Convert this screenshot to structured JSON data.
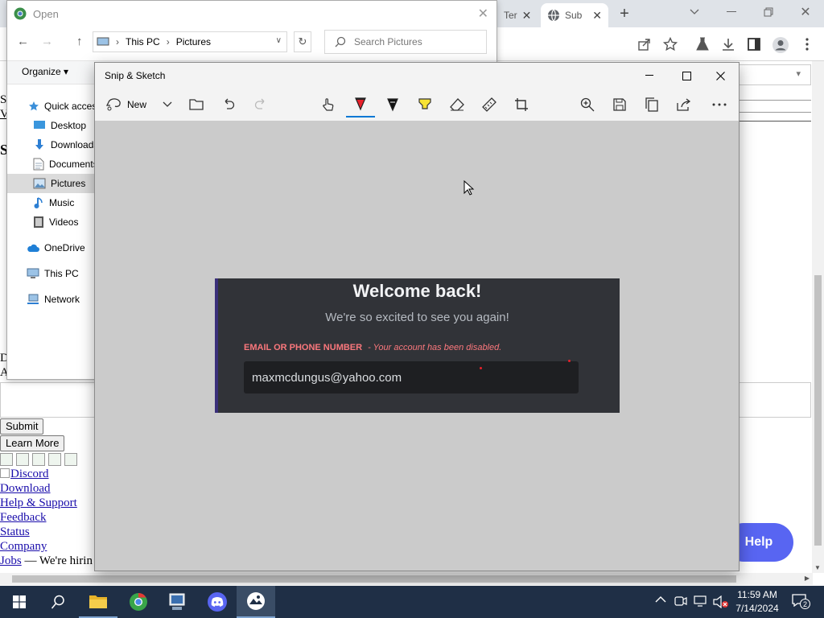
{
  "browser": {
    "tabs": [
      {
        "label": "Ter"
      },
      {
        "label": "Sub"
      }
    ],
    "new_tab_glyph": "+",
    "window_controls": [
      "chevron-down-icon",
      "minimize-icon",
      "restore-icon",
      "close-icon"
    ],
    "toolbar_icons": [
      "share-icon",
      "star-icon",
      "extension-icon",
      "download-icon",
      "sidepanel-icon",
      "profile-icon",
      "more-vert-icon"
    ]
  },
  "webpage": {
    "submit_label": "Submit",
    "learn_more_label": "Learn More",
    "discord_alt": "Discord",
    "links": [
      "Download",
      "Help & Support",
      "Feedback",
      "Status",
      "Company"
    ],
    "jobs_link": "Jobs",
    "jobs_suffix": " — We're hirin",
    "help_button": "Help",
    "left_fragments": [
      "S",
      "V",
      "S",
      "D",
      "A"
    ]
  },
  "open_dialog": {
    "title": "Open",
    "breadcrumb": [
      "This PC",
      "Pictures"
    ],
    "search_placeholder": "Search Pictures",
    "organize_label": "Organize ▾",
    "nav": [
      {
        "label": "Quick access",
        "icon": "star-icon"
      },
      {
        "label": "Desktop",
        "icon": "desktop-icon"
      },
      {
        "label": "Downloads",
        "icon": "download-arrow-icon"
      },
      {
        "label": "Documents",
        "icon": "document-icon"
      },
      {
        "label": "Pictures",
        "icon": "pictures-icon"
      },
      {
        "label": "Music",
        "icon": "music-icon"
      },
      {
        "label": "Videos",
        "icon": "video-icon"
      },
      {
        "label": "OneDrive",
        "icon": "cloud-icon"
      },
      {
        "label": "This PC",
        "icon": "computer-icon"
      },
      {
        "label": "Network",
        "icon": "network-icon"
      }
    ]
  },
  "snip": {
    "title": "Snip & Sketch",
    "new_label": "New",
    "accent": "#0078d4",
    "capture": {
      "heading": "Welcome back!",
      "subheading": "We're so excited to see you again!",
      "field_label": "EMAIL OR PHONE NUMBER",
      "field_error": "- Your account has been disabled.",
      "field_value": "maxmcdungus@yahoo.com",
      "label_color": "#fa777c"
    }
  },
  "taskbar": {
    "time": "11:59 AM",
    "date": "7/14/2024",
    "notification_count": "2",
    "apps": [
      "windows-start-icon",
      "search-icon",
      "file-explorer-icon",
      "chrome-icon",
      "network-monitor-icon",
      "discord-icon",
      "snip-sketch-icon"
    ]
  }
}
